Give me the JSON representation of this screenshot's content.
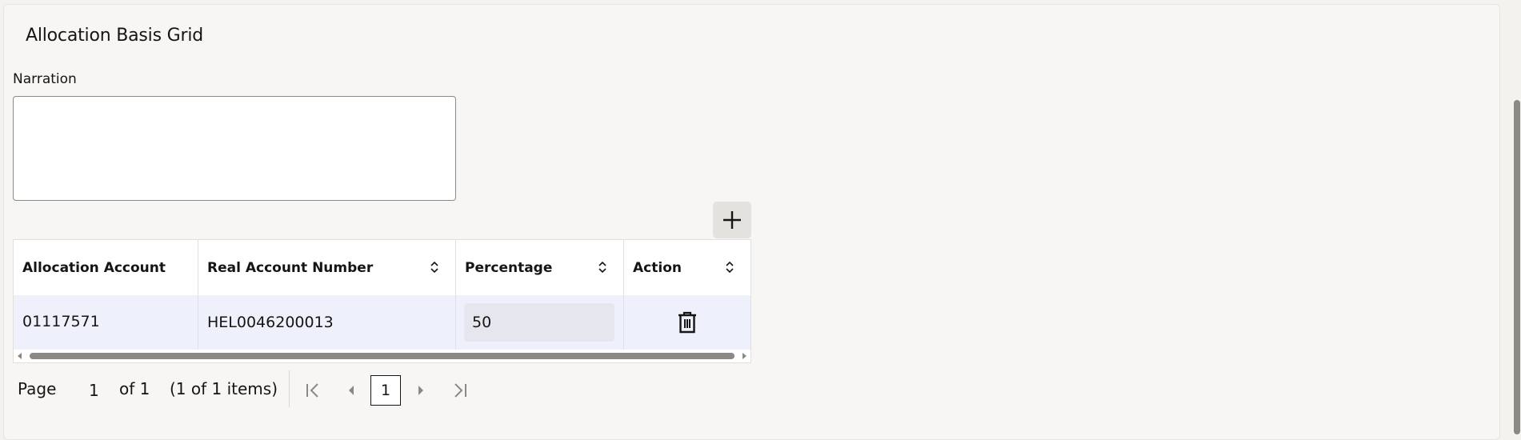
{
  "section": {
    "title": "Allocation Basis Grid",
    "narration_label": "Narration",
    "narration_value": ""
  },
  "grid": {
    "add_icon": "plus-icon",
    "columns": [
      {
        "label": "Allocation Account",
        "sortable": false
      },
      {
        "label": "Real Account Number",
        "sortable": true
      },
      {
        "label": "Percentage",
        "sortable": true
      },
      {
        "label": "Action",
        "sortable": true
      }
    ],
    "rows": [
      {
        "allocation_account": "01117571",
        "real_account_number": "HEL0046200013",
        "percentage": "50",
        "action_icon": "trash-icon"
      }
    ]
  },
  "pagination": {
    "page_label": "Page",
    "page_value": "1",
    "of_label": "of 1",
    "items_label": "(1 of 1 items)",
    "current_page": "1"
  }
}
